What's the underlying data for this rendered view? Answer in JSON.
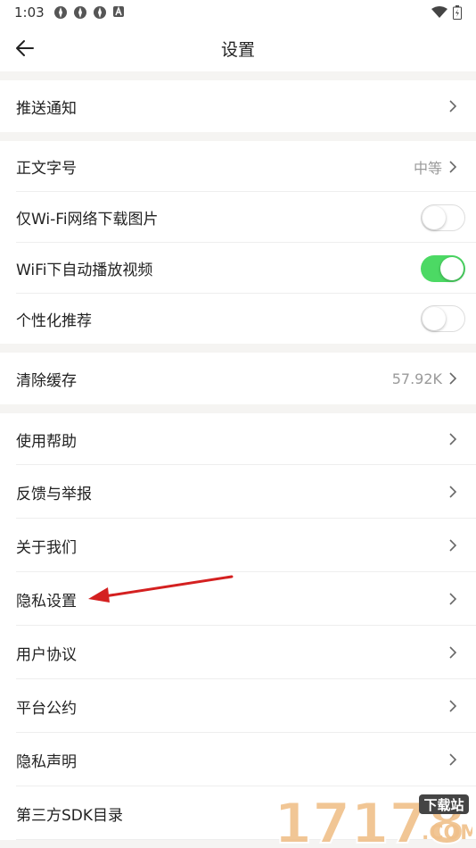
{
  "status": {
    "time": "1:03"
  },
  "header": {
    "title": "设置"
  },
  "rows": {
    "push": {
      "label": "推送通知"
    },
    "font": {
      "label": "正文字号",
      "value": "中等"
    },
    "wifi_images": {
      "label": "仅Wi-Fi网络下载图片",
      "enabled": false
    },
    "wifi_video": {
      "label": "WiFi下自动播放视频",
      "enabled": true
    },
    "personal": {
      "label": "个性化推荐",
      "enabled": false
    },
    "cache": {
      "label": "清除缓存",
      "value": "57.92K"
    },
    "help": {
      "label": "使用帮助"
    },
    "feedback": {
      "label": "反馈与举报"
    },
    "about": {
      "label": "关于我们"
    },
    "privacy_settings": {
      "label": "隐私设置"
    },
    "user_agreement": {
      "label": "用户协议"
    },
    "platform_convention": {
      "label": "平台公约"
    },
    "privacy_statement": {
      "label": "隐私声明"
    },
    "sdk_list": {
      "label": "第三方SDK目录"
    }
  },
  "colors": {
    "toggle_on": "#4cd964",
    "section_gap": "#f5f4f2",
    "annotation_arrow": "#d42020"
  },
  "watermark": {
    "text": "17178",
    "badge": "下载站",
    "domain": ".COM"
  }
}
